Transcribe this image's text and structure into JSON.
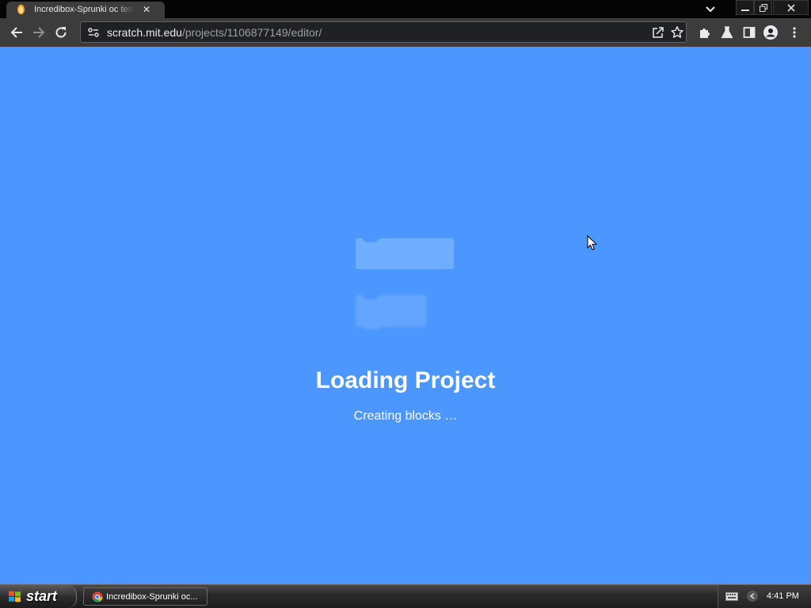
{
  "browser": {
    "tab": {
      "title": "Incredibox-Sprunki oc test",
      "favicon": "scratch-cat-icon"
    },
    "url": {
      "host": "scratch.mit.edu",
      "path": "/projects/1106877149/editor/"
    }
  },
  "page": {
    "background_color": "#4c97ff",
    "title": "Loading Project",
    "status": "Creating blocks …"
  },
  "taskbar": {
    "start_label": "start",
    "task_button": {
      "label": "Incredibox-Sprunki oc...",
      "icon": "chrome-icon"
    },
    "clock": "4:41 PM"
  }
}
